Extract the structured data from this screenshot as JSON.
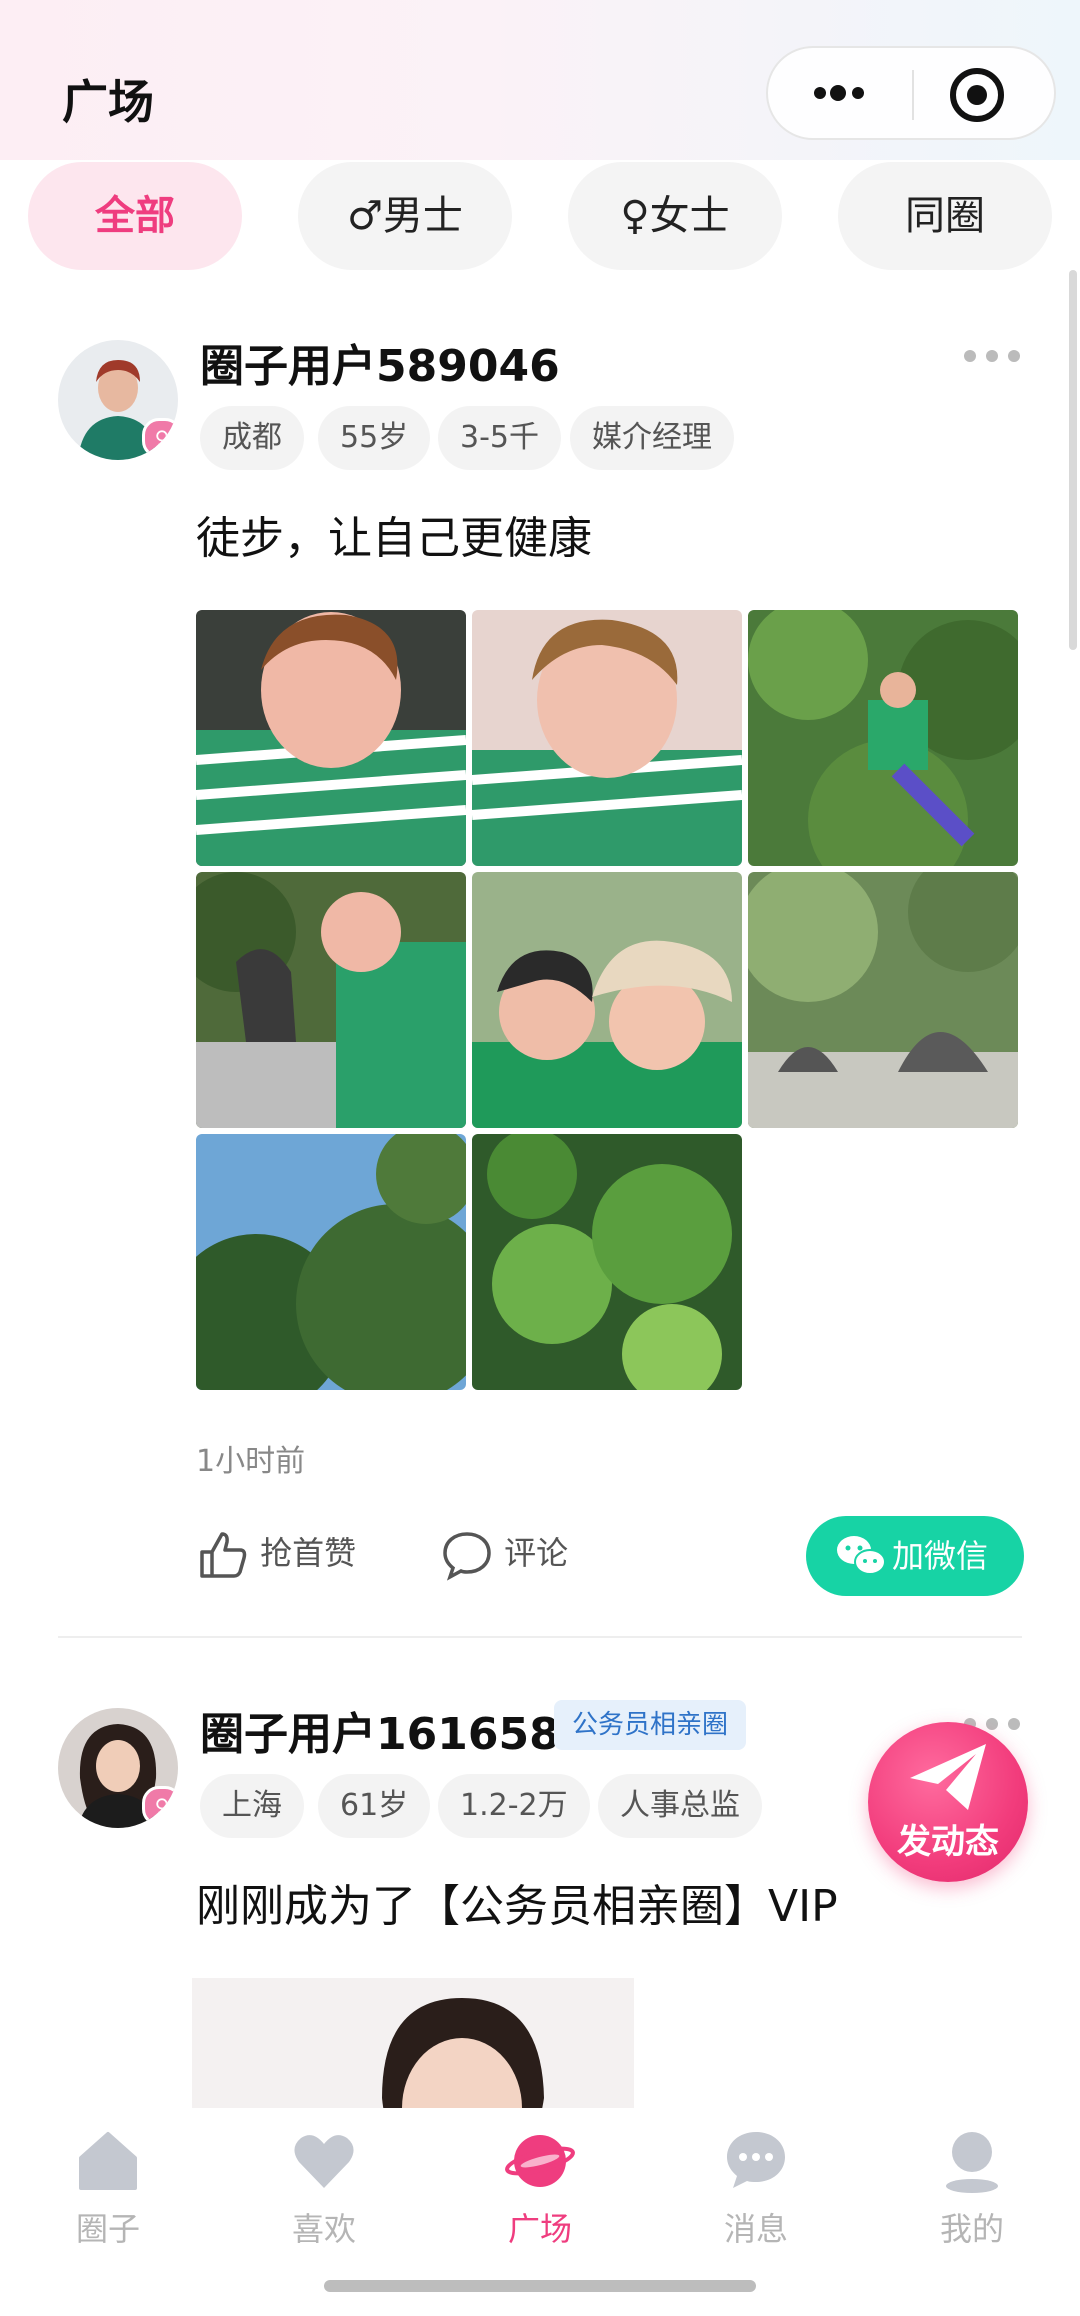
{
  "header": {
    "title": "广场"
  },
  "tabs": [
    {
      "label": "全部",
      "active": true
    },
    {
      "label": "♂男士",
      "active": false
    },
    {
      "label": "♀女士",
      "active": false
    },
    {
      "label": "同圈",
      "active": false
    }
  ],
  "posts": [
    {
      "username": "圈子用户589046",
      "tags": [
        "成都",
        "55岁",
        "3-5千",
        "媒介经理"
      ],
      "text": "徒步，让自己更健康",
      "photo_count": 8,
      "time": "1小时前",
      "like_label": "抢首赞",
      "comment_label": "评论",
      "wechat_label": "加微信"
    },
    {
      "username": "圈子用户161658",
      "circle_badge": "公务员相亲圈",
      "tags": [
        "上海",
        "61岁",
        "1.2-2万",
        "人事总监"
      ],
      "text": "刚刚成为了【公务员相亲圈】VIP"
    }
  ],
  "fab": {
    "label": "发动态"
  },
  "nav": [
    {
      "label": "圈子",
      "icon": "home-icon",
      "active": false
    },
    {
      "label": "喜欢",
      "icon": "heart-icon",
      "active": false
    },
    {
      "label": "广场",
      "icon": "planet-icon",
      "active": true
    },
    {
      "label": "消息",
      "icon": "chat-bubble-icon",
      "active": false
    },
    {
      "label": "我的",
      "icon": "person-icon",
      "active": false
    }
  ],
  "colors": {
    "accent": "#ef3d7f",
    "wechat": "#17d3a5",
    "badge_blue": "#2f73c8"
  }
}
